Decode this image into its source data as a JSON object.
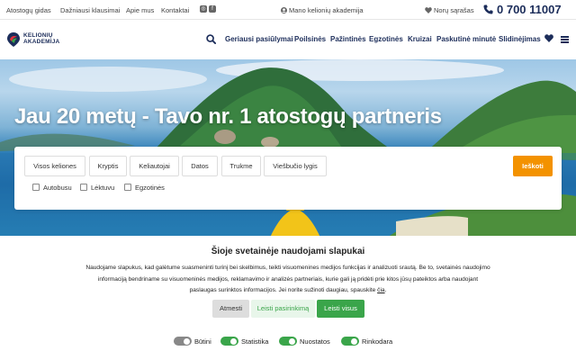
{
  "topbar": {
    "links": [
      "Atostogų gidas",
      "Dažniausi klausimai",
      "Apie mus",
      "Kontaktai"
    ],
    "academy": "Mano kelionių akademija",
    "wishlist": "Norų sąrašas",
    "phone": "0 700 11007"
  },
  "logo": {
    "line1": "KELIONIŲ",
    "line2": "AKADEMIJA"
  },
  "nav": {
    "items": [
      "Geriausi pasiūlymai",
      "Poilsinės",
      "Pažintinės",
      "Egzotinės",
      "Kruizai",
      "Paskutinė minutė",
      "Slidinėjimas"
    ]
  },
  "hero": {
    "headline": "Jau 20 metų - Tavo nr. 1 atostogų partneris"
  },
  "search": {
    "chips": [
      "Visos keliones",
      "Kryptis",
      "Keliautojai",
      "Datos",
      "Trukme",
      "Viešbučio lygis"
    ],
    "submit": "Ieškoti",
    "checkboxes": [
      "Autobusu",
      "Lėktuvu",
      "Egzotinės"
    ]
  },
  "cookie": {
    "title": "Šioje svetainėje naudojami slapukai",
    "text": "Naudojame slapukus, kad galėtume suasmeninti turinį bei skelbimus, teikti visuomenines medijos funkcijas ir analizuoti srautą. Be to, svetainės naudojimo informaciją bendriname su visuomeninės medijos, reklamavimo ir analizės partneriais, kurie gali ją pridėti prie kitos jūsų pateiktos arba naudojant paslaugas surinktos informacijos. Jei norite sužinoti daugiau, spauskite",
    "link": "čia",
    "buttons": {
      "reject": "Atmesti",
      "select": "Leisti pasirinkimą",
      "all": "Leisti visus"
    },
    "toggles": [
      "Būtini",
      "Statistika",
      "Nuostatos",
      "Rinkodara"
    ]
  },
  "colors": {
    "brand": "#1c2d5a",
    "accent": "#f39200",
    "green": "#3aa54a"
  }
}
